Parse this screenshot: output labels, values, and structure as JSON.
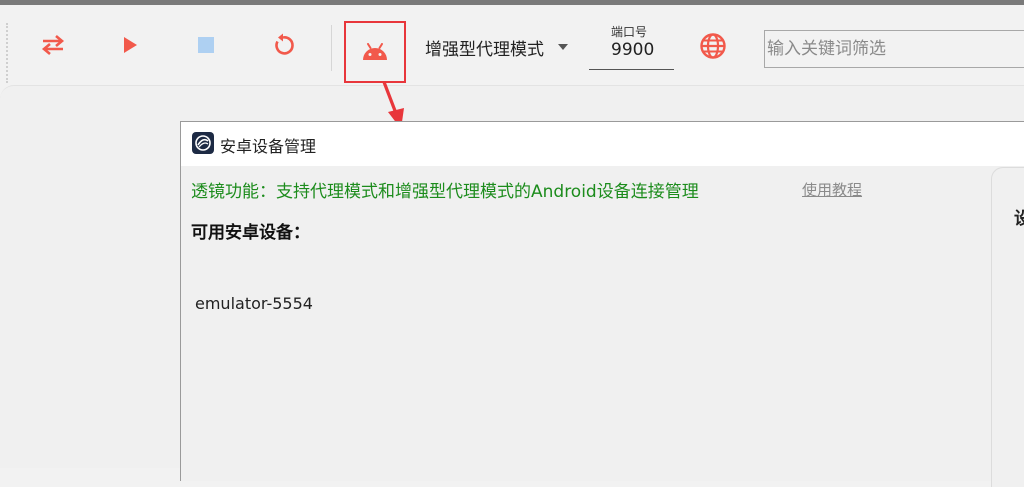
{
  "toolbar": {
    "mode_label": "增强型代理模式",
    "port_label": "端口号",
    "port_value": "9900",
    "search_placeholder": "输入关键词筛选"
  },
  "dialog": {
    "title": "安卓设备管理",
    "feature_text": "透镜功能：支持代理模式和增强型代理模式的Android设备连接管理",
    "tutorial_link": "使用教程",
    "devices_heading": "可用安卓设备：",
    "devices": [
      "emulator-5554"
    ],
    "right_panel_char": "设"
  },
  "colors": {
    "accent_red": "#f2594b",
    "stop_blue": "#aed0f2",
    "feature_green": "#1c8c1c",
    "highlight_red": "#e8363b"
  },
  "icons": {
    "swap": "swap-icon",
    "play": "play-icon",
    "stop": "stop-icon",
    "refresh": "refresh-icon",
    "android": "android-icon",
    "globe": "globe-icon"
  }
}
